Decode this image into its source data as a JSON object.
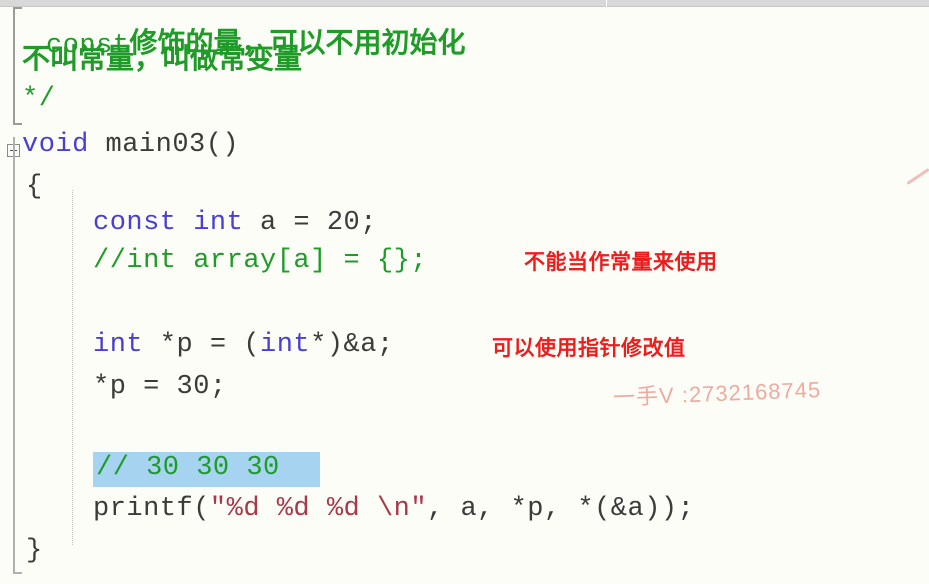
{
  "editor": {
    "background_color": "#fdfdf8",
    "selection_color": "#a6d3ef",
    "comment_color": "#1f9b28",
    "keyword_color": "#4a3fd4",
    "string_color": "#a8384a",
    "plain_color": "#3b3b3b",
    "annotation_color": "#ee1d1d",
    "watermark_color": "#eda79c"
  },
  "code": {
    "comment_line_1_latin": "const",
    "comment_line_1_han": "修饰的量，可以不用初始化",
    "comment_line_2": "不叫常量，叫做常变量",
    "comment_end": "*/",
    "fn_keyword": "void",
    "fn_name": " main03()",
    "brace_open": "{",
    "decl_const": "const int",
    "decl_const_rest": " a = 20;",
    "commented_array": "//int array[a] = {};",
    "ptr_keyword": "int",
    "ptr_rest_a": " *p = (",
    "ptr_keyword_2": "int",
    "ptr_rest_b": "*)&a;",
    "ptr_assign": "*p = 30;",
    "result_comment": "// 30 30 30",
    "printf_call_open": "printf(",
    "printf_quote_open": "\"",
    "printf_format": "%d %d %d \\n",
    "printf_quote_close": "\"",
    "printf_args": ", a, *p, *(&a));",
    "brace_close": "}"
  },
  "annotations": {
    "note_1": "不能当作常量来使用",
    "note_2": "可以使用指针修改值"
  },
  "watermark": {
    "text": "一手V :2732168745"
  }
}
